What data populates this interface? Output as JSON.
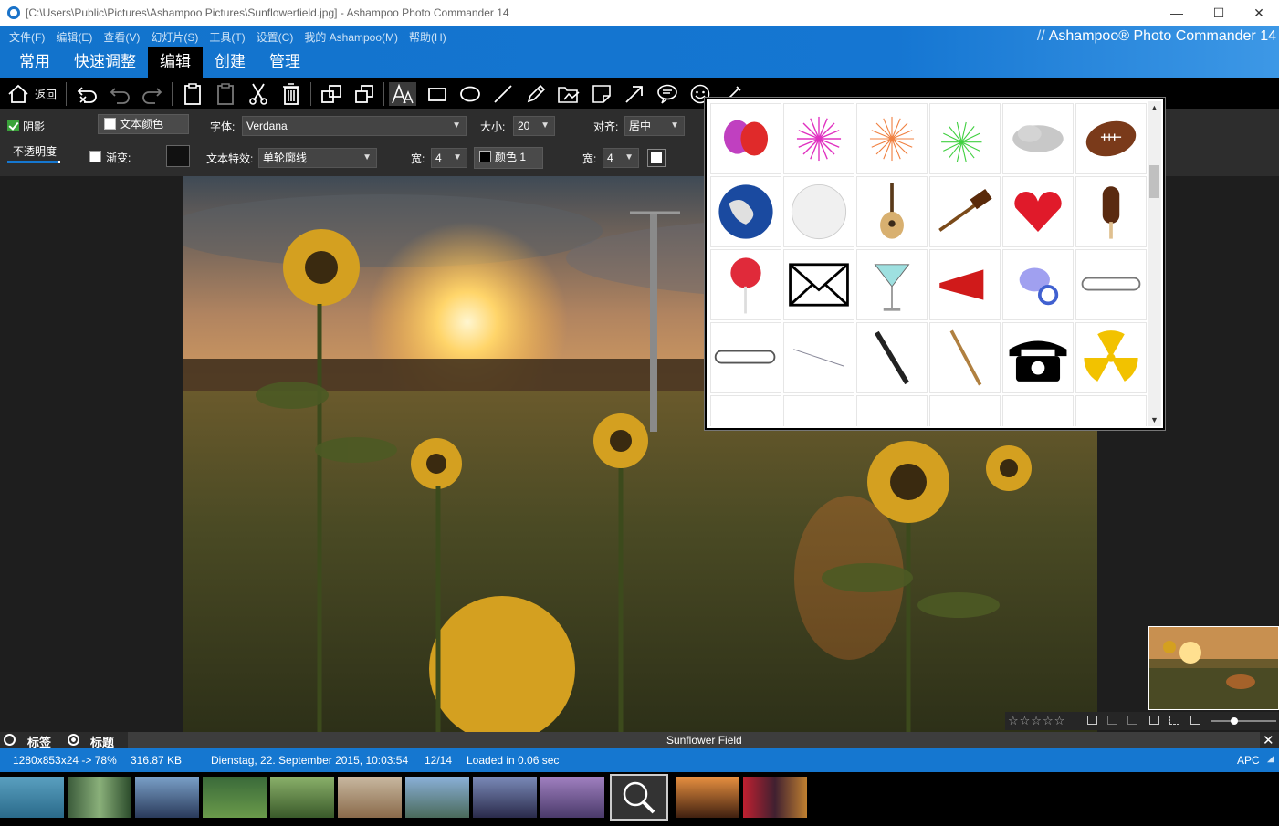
{
  "window": {
    "title": "[C:\\Users\\Public\\Pictures\\Ashampoo Pictures\\Sunflowerfield.jpg] - Ashampoo Photo Commander 14",
    "minimize": "—",
    "maximize": "☐",
    "close": "✕"
  },
  "menu": [
    "文件(F)",
    "编辑(E)",
    "查看(V)",
    "幻灯片(S)",
    "工具(T)",
    "设置(C)",
    "我的 Ashampoo(M)",
    "帮助(H)"
  ],
  "brand": {
    "prefix": "//",
    "name": "Ashampoo® Photo Commander 14"
  },
  "tabs": [
    {
      "label": "常用"
    },
    {
      "label": "快速调整"
    },
    {
      "label": "编辑",
      "active": true
    },
    {
      "label": "创建"
    },
    {
      "label": "管理"
    }
  ],
  "toolbar": {
    "back_label": "返回"
  },
  "options": {
    "shadow_label": "阴影",
    "shadow_checked": true,
    "opacity_label": "不透明度",
    "opacity_level": 0.95,
    "text_color_label": "文本颜色",
    "font_label": "字体:",
    "font_value": "Verdana",
    "size_label": "大小:",
    "size_value": "20",
    "align_label": "对齐:",
    "align_value": "居中",
    "gradient_label": "渐变:",
    "gradient_checked": false,
    "effect_label": "文本特效:",
    "effect_value": "单轮廓线",
    "width_label_1": "宽:",
    "width_value_1": "4",
    "color1_label": "颜色 1",
    "width_label_2": "宽:",
    "width_value_2": "4"
  },
  "clipart": [
    "balloons",
    "fireworks-magenta",
    "fireworks-orange",
    "fireworks-green",
    "cloud",
    "american-football",
    "globe",
    "golf-ball",
    "guitar",
    "gavel",
    "heart",
    "ice-cream",
    "lollipop",
    "envelope",
    "cocktail",
    "megaphone",
    "pacifier",
    "paperclip",
    "paperclip-2",
    "paper-plane",
    "fountain-pen",
    "pencil",
    "telephone",
    "radiation-sign"
  ],
  "info": {
    "tag_label": "标签",
    "title_label": "标题",
    "photo_title": "Sunflower Field"
  },
  "status": {
    "dimensions": "1280x853x24 -> 78%",
    "filesize": "316.87 KB",
    "date": "Dienstag, 22. September 2015, 10:03:54",
    "index": "12/14",
    "loaded": "Loaded in 0.06 sec",
    "mode": "APC"
  },
  "rating": {
    "stars": 0,
    "max": 5
  },
  "colors": {
    "accent": "#1577d0",
    "toolbar": "#000000",
    "panel": "#2d2d2d"
  }
}
